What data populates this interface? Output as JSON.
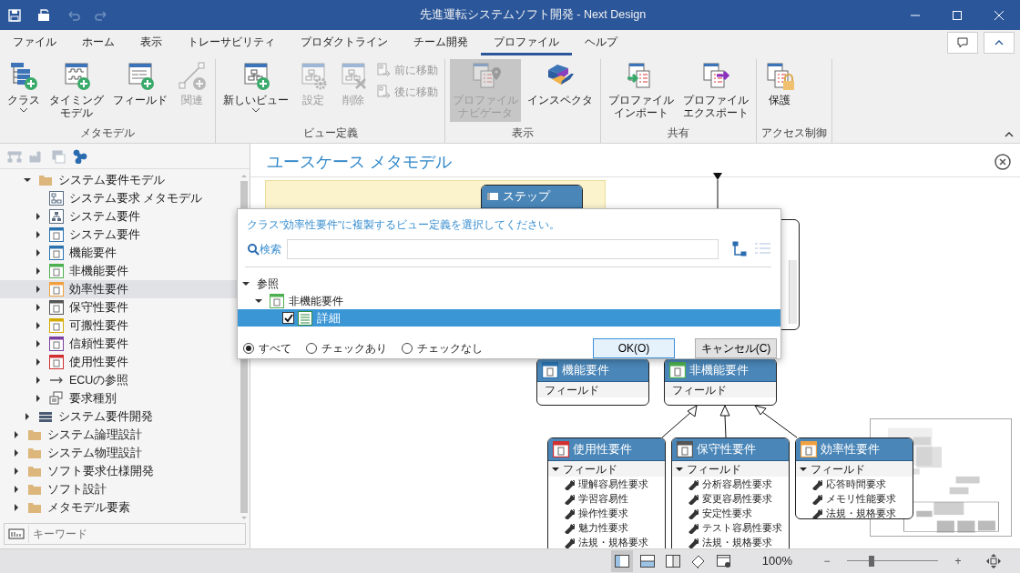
{
  "window": {
    "title": "先進運転システムソフト開発 - Next Design"
  },
  "menu_tabs": [
    {
      "label": "ファイル",
      "selected": false
    },
    {
      "label": "ホーム",
      "selected": false
    },
    {
      "label": "表示",
      "selected": false
    },
    {
      "label": "トレーサビリティ",
      "selected": false
    },
    {
      "label": "プロダクトライン",
      "selected": false
    },
    {
      "label": "チーム開発",
      "selected": false
    },
    {
      "label": "プロファイル",
      "selected": true
    },
    {
      "label": "ヘルプ",
      "selected": false
    }
  ],
  "ribbon": {
    "groups": [
      {
        "label": "メタモデル",
        "buttons": [
          {
            "kind": "large",
            "lines": [
              "クラス"
            ],
            "dropdown": true,
            "disabled": false
          },
          {
            "kind": "large",
            "lines": [
              "タイミング",
              "モデル"
            ],
            "disabled": false
          },
          {
            "kind": "large",
            "lines": [
              "フィールド"
            ],
            "disabled": false
          },
          {
            "kind": "large",
            "lines": [
              "関連"
            ],
            "disabled": true
          }
        ]
      },
      {
        "label": "ビュー定義",
        "buttons": [
          {
            "kind": "large",
            "lines": [
              "新しいビュー"
            ],
            "dropdown": true,
            "disabled": false
          },
          {
            "kind": "large",
            "lines": [
              "設定"
            ],
            "disabled": true
          },
          {
            "kind": "large",
            "lines": [
              "削除"
            ],
            "disabled": true
          },
          {
            "kind": "small",
            "lines": [
              "前に移動"
            ],
            "disabled": true
          },
          {
            "kind": "small",
            "lines": [
              "後に移動"
            ],
            "disabled": true
          }
        ]
      },
      {
        "label": "表示",
        "buttons": [
          {
            "kind": "large",
            "lines": [
              "プロファイル",
              "ナビゲータ"
            ],
            "disabled": true,
            "pressed": true
          },
          {
            "kind": "large",
            "lines": [
              "インスペクタ"
            ],
            "disabled": false
          }
        ]
      },
      {
        "label": "共有",
        "buttons": [
          {
            "kind": "large",
            "lines": [
              "プロファイル",
              "インポート"
            ],
            "disabled": false
          },
          {
            "kind": "large",
            "lines": [
              "プロファイル",
              "エクスポート"
            ],
            "disabled": false
          }
        ]
      },
      {
        "label": "アクセス制御",
        "buttons": [
          {
            "kind": "large",
            "lines": [
              "保護"
            ],
            "disabled": false
          }
        ]
      }
    ]
  },
  "tree_toolbar": [
    {
      "disabled": true
    },
    {
      "disabled": true
    },
    {
      "disabled": true
    },
    {
      "disabled": false
    }
  ],
  "tree": {
    "scrolled_parent_children": [
      {
        "label": "システム要件モデル",
        "kind": "folder",
        "expanded": true,
        "selected": false,
        "children": [
          {
            "label": "システム要求 メタモデル",
            "kind": "diagram",
            "selected": false
          },
          {
            "label": "システム要件",
            "kind": "hierarchy",
            "expanded": false,
            "selected": false
          },
          {
            "label": "システム要件",
            "kind": "class",
            "color": "#2b73b0",
            "expanded": false,
            "selected": false
          },
          {
            "label": "機能要件",
            "kind": "class",
            "color": "#2b73b0",
            "expanded": false,
            "selected": false
          },
          {
            "label": "非機能要件",
            "kind": "class",
            "color": "#4caf50",
            "expanded": false,
            "selected": false
          },
          {
            "label": "効率性要件",
            "kind": "class",
            "color": "#f0a040",
            "expanded": false,
            "selected": true
          },
          {
            "label": "保守性要件",
            "kind": "class",
            "color": "#555555",
            "expanded": false,
            "selected": false
          },
          {
            "label": "可搬性要件",
            "kind": "class",
            "color": "#d4aa00",
            "expanded": false,
            "selected": false
          },
          {
            "label": "信頼性要件",
            "kind": "class",
            "color": "#7b3fa0",
            "expanded": false,
            "selected": false
          },
          {
            "label": "使用性要件",
            "kind": "class",
            "color": "#d03030",
            "expanded": false,
            "selected": false
          },
          {
            "label": "ECUの参照",
            "kind": "reference",
            "expanded": false,
            "selected": false
          },
          {
            "label": "要求種別",
            "kind": "enum",
            "expanded": false,
            "selected": false
          }
        ]
      },
      {
        "label": "システム要件開発",
        "kind": "list",
        "expanded": false,
        "selected": false
      }
    ],
    "items": [
      {
        "label": "システム論理設計",
        "kind": "folder",
        "expanded": false,
        "selected": false
      },
      {
        "label": "システム物理設計",
        "kind": "folder",
        "expanded": false,
        "selected": false
      },
      {
        "label": "ソフト要求仕様開発",
        "kind": "folder",
        "expanded": false,
        "selected": false
      },
      {
        "label": "ソフト設計",
        "kind": "folder",
        "expanded": false,
        "selected": false
      },
      {
        "label": "メタモデル要素",
        "kind": "folder",
        "expanded": false,
        "selected": false
      }
    ]
  },
  "keyword_field": {
    "placeholder": "キーワード"
  },
  "canvas": {
    "title": "ユースケース メタモデル",
    "nodes": [
      {
        "title": "ステップ",
        "kind": "entity"
      },
      {
        "title": "機能要件",
        "kind": "class",
        "color": "#2b73b0",
        "sections": [
          {
            "label": "フィールド"
          }
        ]
      },
      {
        "title": "非機能要件",
        "kind": "class",
        "color": "#4caf50",
        "sections": [
          {
            "label": "フィールド"
          }
        ]
      },
      {
        "title": "使用性要件",
        "kind": "class",
        "color": "#d03030",
        "sections": [
          {
            "label": "フィールド",
            "expanded": true,
            "fields": [
              "理解容易性要求",
              "学習容易性",
              "操作性要求",
              "魅力性要求",
              "法規・規格要求"
            ]
          }
        ]
      },
      {
        "title": "保守性要件",
        "kind": "class",
        "color": "#555555",
        "sections": [
          {
            "label": "フィールド",
            "expanded": true,
            "fields": [
              "分析容易性要求",
              "変更容易性要求",
              "安定性要求",
              "テスト容易性要求",
              "法規・規格要求"
            ]
          }
        ]
      },
      {
        "title": "効率性要件",
        "kind": "class",
        "color": "#f0a040",
        "sections": [
          {
            "label": "フィールド",
            "expanded": true,
            "fields": [
              "応答時間要求",
              "メモリ性能要求",
              "法規・規格要求"
            ]
          }
        ]
      }
    ]
  },
  "dialog": {
    "prompt": "クラス\"効率性要件\"に複製するビュー定義を選択してください。",
    "search_label": "検索",
    "view_toggle": [
      {
        "selected": true
      },
      {
        "selected": false
      }
    ],
    "tree": [
      {
        "label": "参照",
        "expanded": true,
        "children": [
          {
            "label": "非機能要件",
            "kind": "class",
            "color": "#4caf50",
            "expanded": true,
            "children": [
              {
                "label": "詳細",
                "kind": "view",
                "checked": true,
                "selected": true
              }
            ]
          }
        ]
      }
    ],
    "filters": [
      {
        "label": "すべて",
        "selected": true
      },
      {
        "label": "チェックあり",
        "selected": false
      },
      {
        "label": "チェックなし",
        "selected": false
      }
    ],
    "buttons": [
      "OK(O)",
      "キャンセル(C)"
    ]
  },
  "status_bar": {
    "view_buttons": [
      {
        "selected": true
      },
      {
        "selected": false
      },
      {
        "selected": false
      },
      {
        "selected": false
      },
      {
        "selected": false
      }
    ],
    "zoom": "100%",
    "zoom_minus": "−",
    "zoom_plus": "+",
    "zoom_slider": {
      "level": 0.27
    }
  }
}
